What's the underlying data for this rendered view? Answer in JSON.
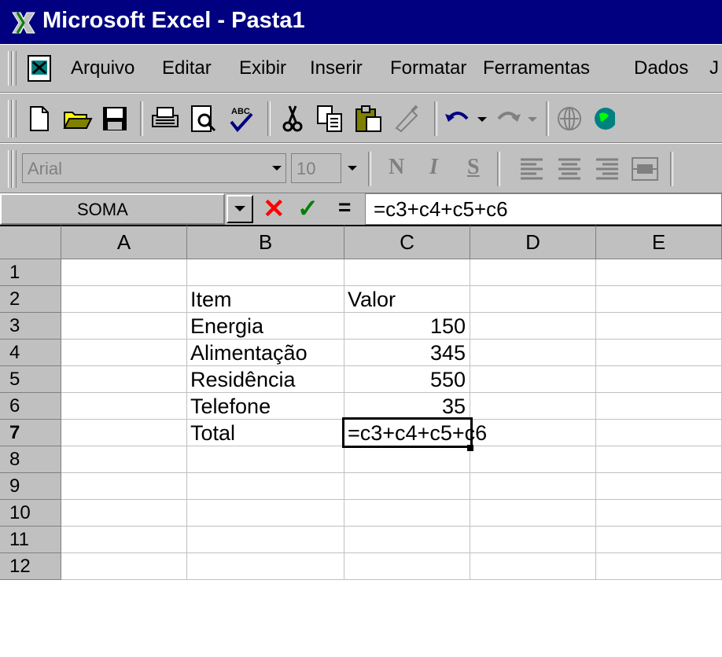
{
  "title": "Microsoft Excel - Pasta1",
  "menu": [
    "Arquivo",
    "Editar",
    "Exibir",
    "Inserir",
    "Formatar",
    "Ferramentas",
    "Dados",
    "J"
  ],
  "format_toolbar": {
    "font": "Arial",
    "size": "10",
    "bold": "N",
    "italic": "I",
    "underline": "S"
  },
  "formula_bar": {
    "name_box": "SOMA",
    "cancel_symbol": "✕",
    "enter_symbol": "✓",
    "equals": "=",
    "formula": "=c3+c4+c5+c6"
  },
  "columns": [
    "A",
    "B",
    "C",
    "D",
    "E"
  ],
  "rows": [
    "1",
    "2",
    "3",
    "4",
    "5",
    "6",
    "7",
    "8",
    "9",
    "10",
    "11",
    "12"
  ],
  "cells": {
    "B2": "Item",
    "C2": "Valor",
    "B3": "Energia",
    "C3": "150",
    "B4": "Alimentação",
    "C4": "345",
    "B5": "Residência",
    "C5": "550",
    "B6": "Telefone",
    "C6": "35",
    "B7": "Total",
    "C7": "=c3+c4+c5+c6"
  },
  "active_cell": "C7",
  "colors": {
    "titlebar": "#000080",
    "face": "#c0c0c0",
    "cancel": "#ff0000",
    "enter": "#008000"
  }
}
